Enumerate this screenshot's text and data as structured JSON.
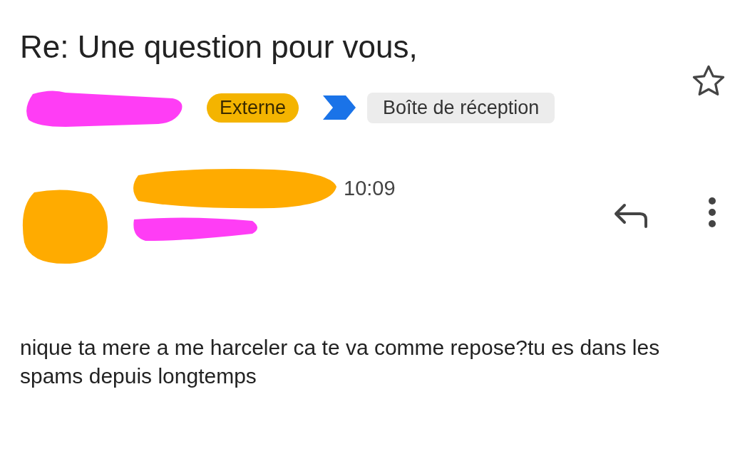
{
  "subject": "Re: Une question pour vous,",
  "labels": [
    {
      "kind": "external",
      "text": "Externe"
    },
    {
      "kind": "folder",
      "text": "Boîte de réception",
      "important": true
    }
  ],
  "starred": false,
  "message": {
    "time": "10:09",
    "body": "nique ta mere a me harceler ca te va comme repose?tu es dans les spams depuis longtemps"
  }
}
